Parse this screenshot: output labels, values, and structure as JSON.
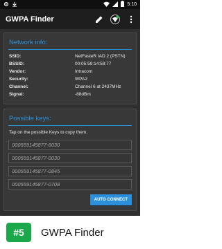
{
  "status_bar": {
    "time": "5:10",
    "icons": [
      "gear-icon",
      "download-icon",
      "wifi-icon",
      "signal-icon",
      "battery-icon"
    ]
  },
  "app_bar": {
    "title": "GWPA Finder",
    "actions": [
      "edit-icon",
      "wifi-scan-icon",
      "overflow-menu-icon"
    ]
  },
  "network_card": {
    "title": "Network info:",
    "rows": [
      {
        "label": "SSID:",
        "value": "NetFasteR IAD 2 (PSTN)"
      },
      {
        "label": "BSSID:",
        "value": "00:05:59:14:58:77"
      },
      {
        "label": "Vendor:",
        "value": "Intracom"
      },
      {
        "label": "Security:",
        "value": "WPA2"
      },
      {
        "label": "Channel:",
        "value": "Channel 6 at 2437MHz"
      },
      {
        "label": "Signal:",
        "value": "-88dBm"
      }
    ]
  },
  "keys_card": {
    "title": "Possible keys:",
    "hint": "Tap on the possible Keys to copy them.",
    "keys": [
      "000559145877-6030",
      "000559145877-0030",
      "000559145877-0845",
      "000559145877-0708"
    ],
    "button_label": "AUTO CONNECT"
  },
  "footer": {
    "rank": "#5",
    "title": "GWPA Finder"
  },
  "colors": {
    "accent": "#2b90d9",
    "rank_badge": "#1aa84a",
    "background": "#2f2f2f"
  }
}
